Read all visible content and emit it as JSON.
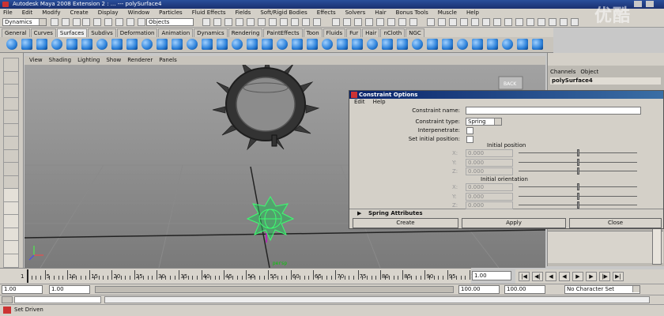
{
  "window": {
    "title": "Autodesk Maya 2008 Extension 2 : ...  ---  polySurface4"
  },
  "menubar": [
    "File",
    "Edit",
    "Modify",
    "Create",
    "Display",
    "Window",
    "Particles",
    "Fluid Effects",
    "Fields",
    "Soft/Rigid Bodies",
    "Effects",
    "Solvers",
    "Hair",
    "Bonus Tools",
    "Muscle",
    "Help"
  ],
  "statusline": {
    "menuset": "Dynamics",
    "selection_mode": "Objects"
  },
  "shelf_tabs": [
    "General",
    "Curves",
    "Surfaces",
    "Subdivs",
    "Deformation",
    "Animation",
    "Dynamics",
    "Rendering",
    "PaintEffects",
    "Toon",
    "Fluids",
    "Fur",
    "Hair",
    "nCloth",
    "NGC"
  ],
  "shelf_active": "Surfaces",
  "viewport": {
    "menu": [
      "View",
      "Shading",
      "Lighting",
      "Show",
      "Renderer",
      "Panels"
    ],
    "camera_label": "persp",
    "back_label": "BACK"
  },
  "channel_box": {
    "tabs": [
      "Channels",
      "Object"
    ],
    "object_name": "polySurface4"
  },
  "dialog": {
    "title": "Constraint Options",
    "menu": [
      "Edit",
      "Help"
    ],
    "constraint_name_label": "Constraint name:",
    "constraint_name_value": "",
    "constraint_type_label": "Constraint type:",
    "constraint_type_value": "Spring",
    "interpenetrate_label": "Interpenetrate:",
    "set_initial_position_label": "Set initial position:",
    "initial_position_header": "Initial position",
    "initial_orientation_header": "Initial orientation",
    "axes": [
      "X:",
      "Y:",
      "Z:"
    ],
    "field_value": "0.000",
    "slider_fraction": 0.5,
    "spring_attributes": "Spring Attributes",
    "buttons": {
      "create": "Create",
      "apply": "Apply",
      "close": "Close"
    }
  },
  "timeline": {
    "ticks": [
      "5",
      "10",
      "15",
      "20",
      "25",
      "30",
      "35",
      "40",
      "45",
      "50",
      "55",
      "60",
      "65",
      "70",
      "75",
      "80",
      "85",
      "90",
      "95",
      "100"
    ],
    "first_tick": "1",
    "current_frame": "1.00"
  },
  "range": {
    "start": "1.00",
    "playback_start": "1.00",
    "playback_end": "100.00",
    "end": "100.00",
    "character_set": "No Character Set"
  },
  "helpline": {
    "text": "Set Driven"
  },
  "watermark": "优酷",
  "colors": {
    "title_blue": "#1a3070",
    "viewport_grey": "#909090",
    "nurbs_green": "#3cff70"
  }
}
